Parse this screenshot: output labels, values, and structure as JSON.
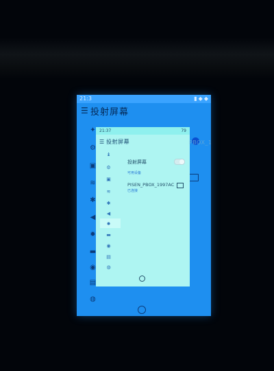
{
  "outer": {
    "status_time": "21:3",
    "header_title": "投射屏幕",
    "sidebar_icons": [
      "bluetooth-icon",
      "gear-icon",
      "monitor-icon",
      "wifi-icon",
      "bluetooth-icon",
      "volume-icon",
      "brightness-icon",
      "battery-icon",
      "location-icon",
      "lock-icon",
      "globe-icon"
    ]
  },
  "inner": {
    "status_time": "21:37",
    "status_battery": "79",
    "header_title": "投射屏幕",
    "cast_label": "投射屏幕",
    "section_label": "可用设备",
    "ghost_text": "PBOX_1997AC",
    "device_name": "PISEN_PBOX_1997AC",
    "device_status": "已连接",
    "sidebar_icons": [
      "shirt-icon",
      "gear-icon",
      "monitor-icon",
      "wifi-icon",
      "bluetooth-icon",
      "volume-icon",
      "brightness-icon",
      "battery-icon",
      "location-icon",
      "lock-icon",
      "globe-icon"
    ]
  }
}
